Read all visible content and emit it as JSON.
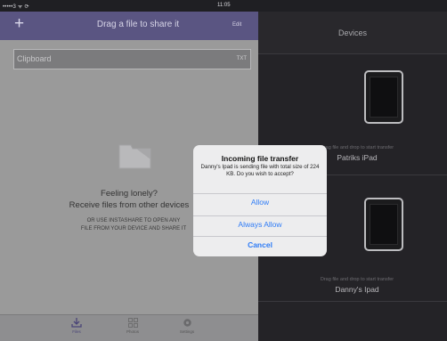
{
  "status": {
    "left": "•••••3 ᯤ ⟳",
    "time": "11:05"
  },
  "left": {
    "header": {
      "title": "Drag a file to share it",
      "edit": "Edit"
    },
    "clipboard": {
      "label": "Clipboard",
      "badge": "TXT"
    },
    "empty": {
      "title": "Feeling lonely?",
      "subtitle": "Receive files from other devices",
      "hint_line1": "OR USE INSTASHARE TO OPEN ANY",
      "hint_line2": "FILE FROM YOUR DEVICE AND SHARE IT"
    },
    "tabs": [
      {
        "label": "Files"
      },
      {
        "label": "Photos"
      },
      {
        "label": "Settings"
      }
    ]
  },
  "right": {
    "title": "Devices",
    "devices": [
      {
        "hint": "Drag file and drop to start transfer",
        "name": "Patriks iPad"
      },
      {
        "hint": "Drag file and drop to start transfer",
        "name": "Danny's Ipad"
      }
    ]
  },
  "dialog": {
    "title": "Incoming file transfer",
    "message": "Danny's Ipad is sending file with total size of 224 KB. Do you wish to accept?",
    "buttons": [
      "Allow",
      "Always Allow",
      "Cancel"
    ]
  },
  "colors": {
    "accent": "#5a5582",
    "link": "#2f7cf6"
  },
  "icons": [
    "plus-icon",
    "download-icon",
    "grid-icon",
    "gear-icon",
    "ipad-icon",
    "empty-folder-icon"
  ]
}
